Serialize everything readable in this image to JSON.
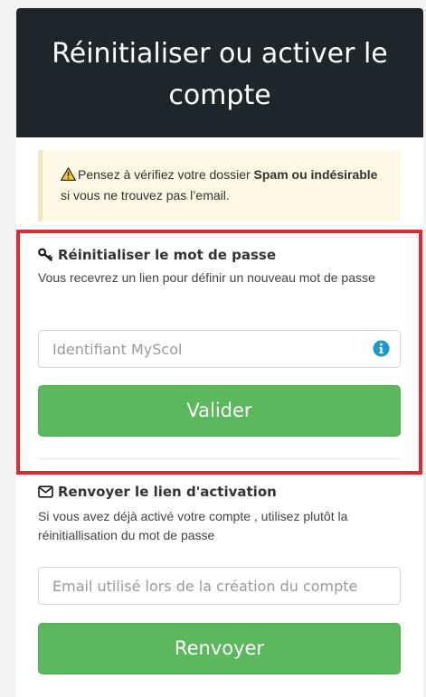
{
  "header": {
    "title": "Réinitialiser ou activer le compte"
  },
  "alert": {
    "icon": "warning-icon",
    "text_before": "Pensez à vérifiez votre dossier ",
    "text_bold": "Spam ou indésirable",
    "text_after": " si vous ne trouvez pas l’email.",
    "background_color": "#fcf8e3"
  },
  "reset_section": {
    "icon": "key-icon",
    "title": "Réinitialiser le mot de passe",
    "description": "Vous recevrez un lien pour définir un nouveau mot de passe",
    "input_placeholder": "Identifiant MyScol",
    "input_value": "",
    "info_icon": "info-circle-icon",
    "button_label": "Valider",
    "highlight_color": "#e0282e"
  },
  "activation_section": {
    "icon": "envelope-icon",
    "title": "Renvoyer le lien d'activation",
    "description": "Si vous avez déjà activé votre compte , utilisez plutôt la réinitiallisation du mot de passe",
    "input_placeholder": "Email utilisé lors de la création du compte",
    "input_value": "",
    "button_label": "Renvoyer"
  },
  "colors": {
    "header_bg": "#1e252b",
    "button_bg": "#5cb85c",
    "info_icon": "#1b9bc8"
  }
}
